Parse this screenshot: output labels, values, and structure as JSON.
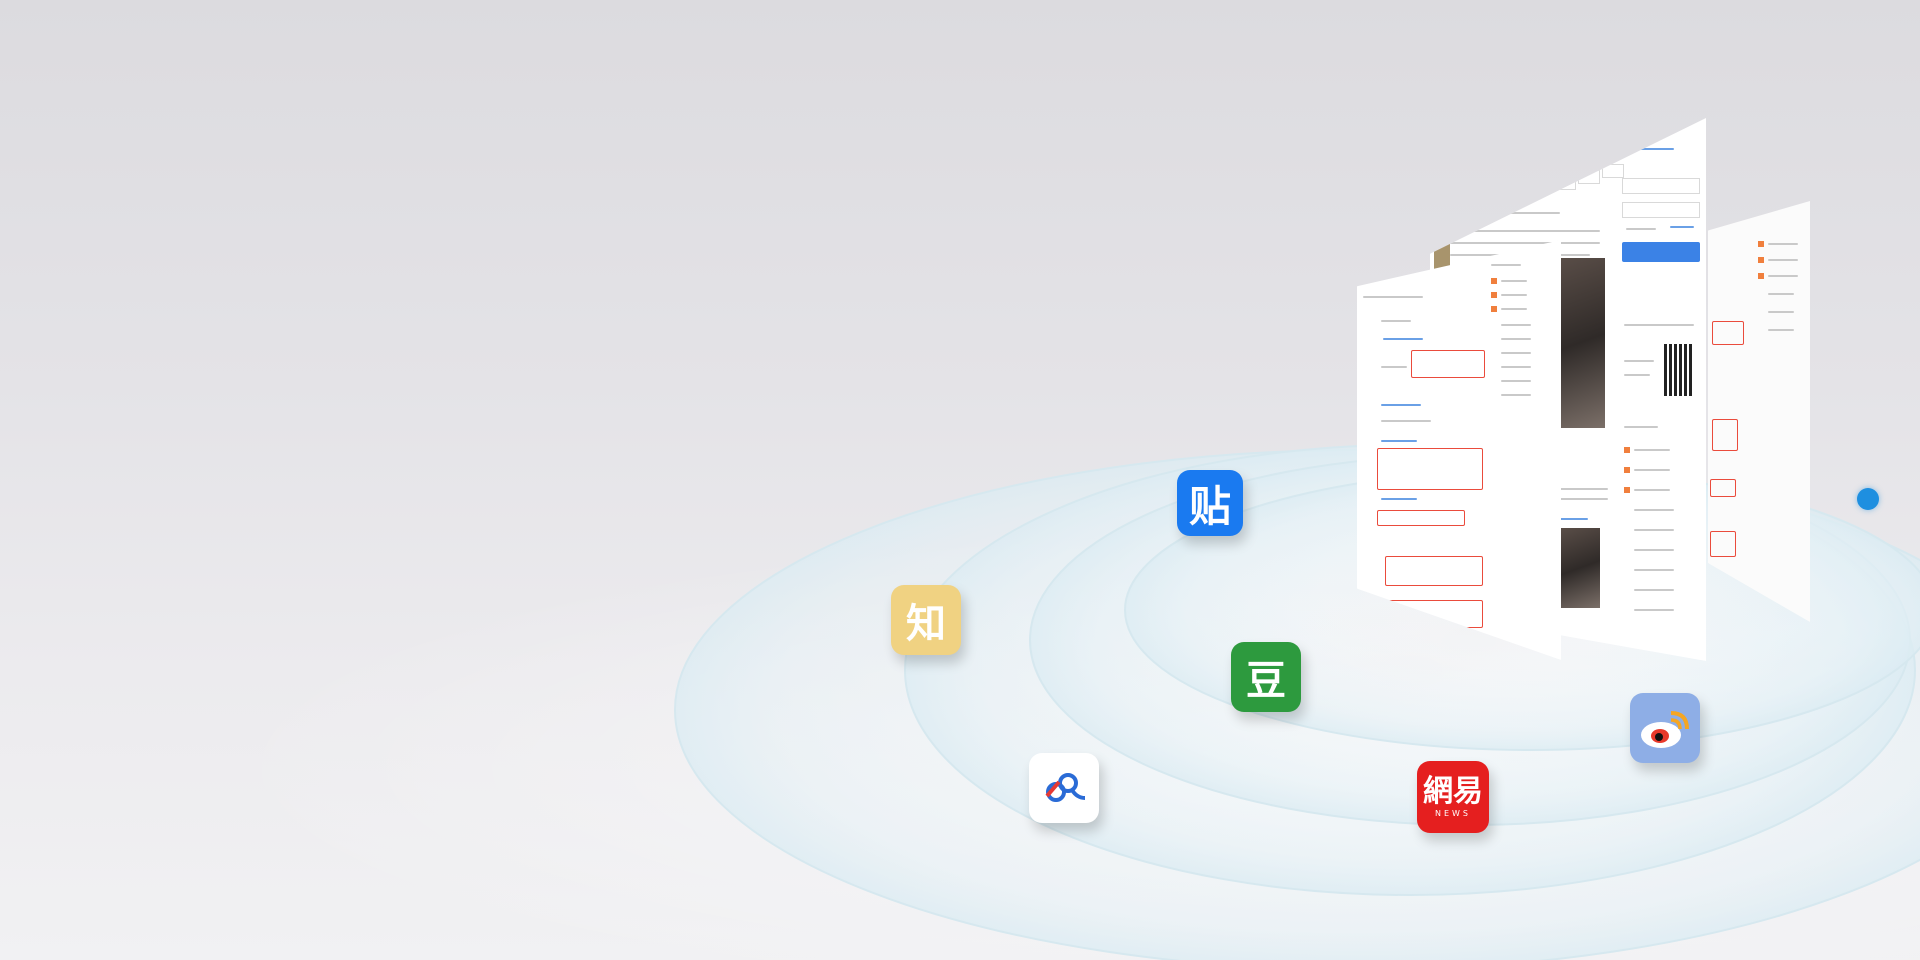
{
  "apps": {
    "tieba": {
      "glyph": "贴",
      "icon": "tieba-icon",
      "color": "#1a7af0"
    },
    "zhihu": {
      "glyph": "知",
      "icon": "zhihu-icon",
      "color": "#f0d282"
    },
    "douban": {
      "glyph": "豆",
      "icon": "douban-icon",
      "color": "#2d9a3e"
    },
    "baidu_zhidao": {
      "icon": "baidu-zhidao-icon",
      "color": "#ffffff"
    },
    "netease": {
      "glyph": "網易",
      "sub": "NEWS",
      "icon": "netease-news-icon",
      "color": "#e51f1f"
    },
    "weibo": {
      "icon": "weibo-icon",
      "color": "#8eaee6"
    }
  },
  "accent_dot_color": "#1e8fe0",
  "background_color": "#e4e3e7"
}
